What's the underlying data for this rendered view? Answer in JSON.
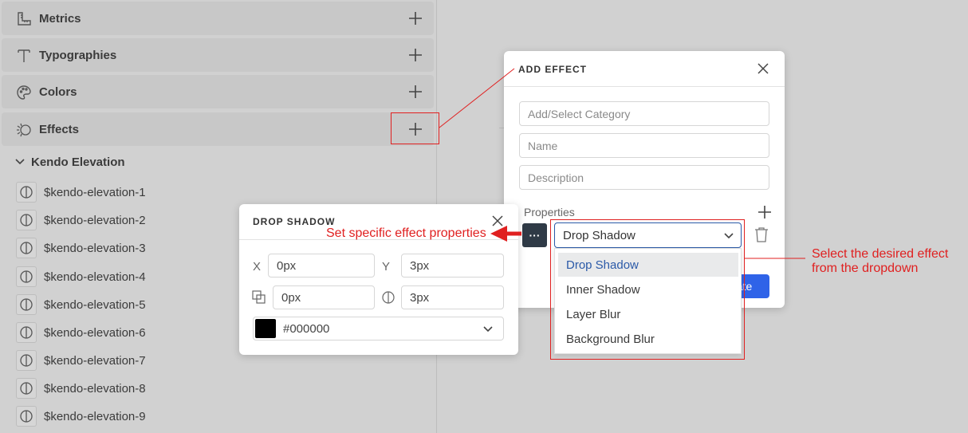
{
  "sidebar": {
    "sections": [
      {
        "label": "Metrics",
        "icon": "ruler-icon"
      },
      {
        "label": "Typographies",
        "icon": "text-icon"
      },
      {
        "label": "Colors",
        "icon": "palette-icon"
      },
      {
        "label": "Effects",
        "icon": "effects-icon"
      }
    ],
    "group": {
      "label": "Kendo Elevation"
    },
    "items": [
      "$kendo-elevation-1",
      "$kendo-elevation-2",
      "$kendo-elevation-3",
      "$kendo-elevation-4",
      "$kendo-elevation-5",
      "$kendo-elevation-6",
      "$kendo-elevation-7",
      "$kendo-elevation-8",
      "$kendo-elevation-9"
    ]
  },
  "add_effect": {
    "title": "ADD EFFECT",
    "category_placeholder": "Add/Select Category",
    "name_placeholder": "Name",
    "description_placeholder": "Description",
    "properties_label": "Properties",
    "more_label": "···",
    "selected_effect": "Drop Shadow",
    "create_label": "ate"
  },
  "dropdown": {
    "options": [
      "Drop Shadow",
      "Inner Shadow",
      "Layer Blur",
      "Background Blur"
    ]
  },
  "drop_shadow": {
    "title": "DROP SHADOW",
    "x_label": "X",
    "x_value": "0px",
    "y_label": "Y",
    "y_value": "3px",
    "spread_value": "0px",
    "blur_value": "3px",
    "color_value": "#000000"
  },
  "annotations": {
    "properties_note": "Set specific effect properties",
    "dropdown_note_line1": "Select the desired effect",
    "dropdown_note_line2": "from the dropdown"
  },
  "colors": {
    "accent": "#2f63e8",
    "annotation": "#e02020",
    "swatch": "#000000"
  }
}
